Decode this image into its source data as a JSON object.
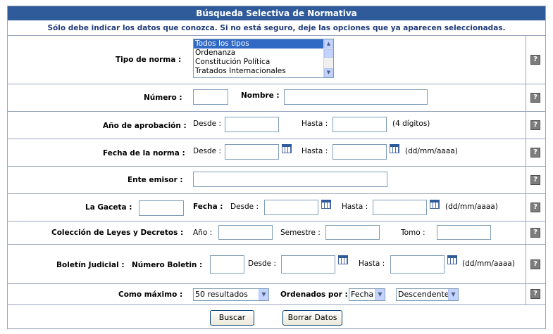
{
  "header": {
    "title": "Búsqueda Selectiva de Normativa",
    "note": "Sólo debe indicar los datos que conozca. Si no está seguro, deje las opciones que ya aparecen seleccionadas."
  },
  "tipo": {
    "label": "Tipo de norma :",
    "options": [
      "Todos los tipos",
      "Ordenanza",
      "Constitución Política",
      "Tratados Internacionales"
    ]
  },
  "numero": {
    "label": "Número :",
    "nombre_label": "Nombre :"
  },
  "anio": {
    "label": "Año de aprobación :",
    "desde": "Desde :",
    "hasta": "Hasta :",
    "hint": "(4 dígitos)"
  },
  "fecha": {
    "label": "Fecha de la norma :",
    "desde": "Desde :",
    "hasta": "Hasta :",
    "hint": "(dd/mm/aaaa)"
  },
  "ente": {
    "label": "Ente emisor :"
  },
  "gaceta": {
    "label": "La Gaceta :",
    "fecha_label": "Fecha :",
    "desde": "Desde :",
    "hasta": "Hasta :",
    "hint": "(dd/mm/aaaa)"
  },
  "coleccion": {
    "label": "Colección de Leyes y Decretos :",
    "anio": "Año :",
    "semestre": "Semestre :",
    "tomo": "Tomo :"
  },
  "boletin": {
    "label": "Boletín Judicial :",
    "numero_label": "Número Boletin :",
    "desde": "Desde :",
    "hasta": "Hasta :",
    "hint": "(dd/mm/aaaa)"
  },
  "limite": {
    "label": "Como máximo :",
    "value": "50 resultados",
    "orden_label": "Ordenados por :",
    "orden_value": "Fecha",
    "dir_value": "Descendente"
  },
  "buttons": {
    "buscar": "Buscar",
    "borrar": "Borrar Datos"
  },
  "icons": {
    "help": "help-question-icon",
    "calendar": "calendar-icon",
    "dropdown": "chevron-down-icon"
  },
  "colors": {
    "header_bg": "#2f5b9a",
    "note_text": "#1f3a78",
    "border": "#9aa6bd",
    "selected": "#316ac5"
  }
}
